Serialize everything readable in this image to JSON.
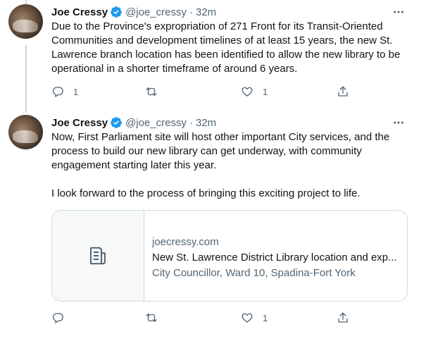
{
  "tweets": [
    {
      "author_name": "Joe Cressy",
      "handle": "@joe_cressy",
      "separator": "·",
      "time": "32m",
      "paragraphs": [
        "Due to the Province's expropriation of 271 Front for its Transit-Oriented Communities and development timelines of at least 15 years, the new St. Lawrence branch location has been identified to allow the new library to be operational in a shorter timeframe of around 6 years."
      ],
      "reply_count": "1",
      "retweet_count": "",
      "like_count": "1"
    },
    {
      "author_name": "Joe Cressy",
      "handle": "@joe_cressy",
      "separator": "·",
      "time": "32m",
      "paragraphs": [
        "Now, First Parliament site will host other important City services, and the process to build our new library can get underway, with community engagement starting later this year.",
        "I look forward to the process of bringing this exciting project to life."
      ],
      "card": {
        "domain": "joecressy.com",
        "title": "New St. Lawrence District Library location and exp...",
        "description": "City Councillor, Ward 10, Spadina-Fort York"
      },
      "reply_count": "",
      "retweet_count": "",
      "like_count": "1"
    }
  ],
  "colors": {
    "verified": "#1d9bf0",
    "secondary_text": "#536471",
    "border": "#cfd9de"
  },
  "icons": [
    "verified-badge-icon",
    "more-icon",
    "reply-icon",
    "retweet-icon",
    "like-icon",
    "share-icon",
    "article-icon"
  ]
}
